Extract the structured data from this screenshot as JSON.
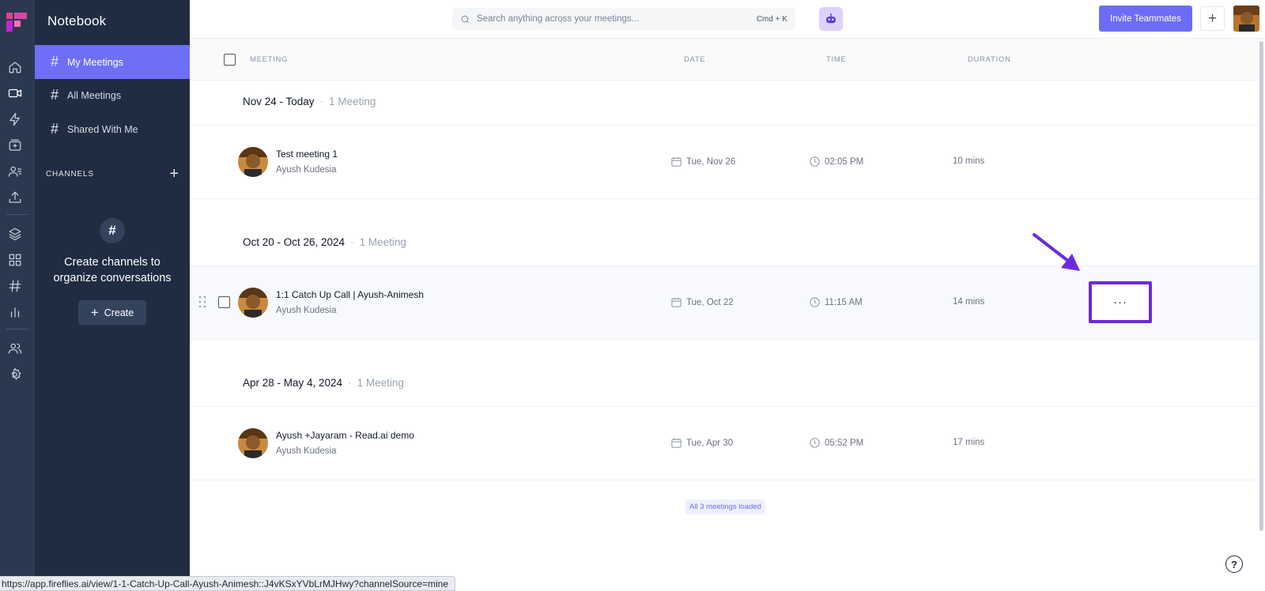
{
  "rail": {
    "items": [
      {
        "icon": "home-icon"
      },
      {
        "icon": "video-icon",
        "active": true
      },
      {
        "icon": "lightning-icon"
      },
      {
        "icon": "inbox-icon"
      },
      {
        "icon": "contacts-icon"
      },
      {
        "icon": "upload-icon"
      },
      {
        "icon": "layers-icon"
      },
      {
        "icon": "apps-grid-icon"
      },
      {
        "icon": "hash-icon"
      },
      {
        "icon": "analytics-icon"
      },
      {
        "icon": "team-icon"
      },
      {
        "icon": "settings-icon"
      }
    ]
  },
  "sidebar": {
    "title": "Notebook",
    "items": [
      {
        "label": "My Meetings",
        "active": true
      },
      {
        "label": "All Meetings"
      },
      {
        "label": "Shared With Me"
      }
    ],
    "channels_label": "CHANNELS",
    "empty_text": "Create channels to organize conversations",
    "create_label": "Create"
  },
  "header": {
    "search_placeholder": "Search anything across your meetings...",
    "search_shortcut": "Cmd + K",
    "invite_label": "Invite Teammates",
    "add_label": "+"
  },
  "columns": {
    "meeting": "MEETING",
    "date": "DATE",
    "time": "TIME",
    "duration": "DURATION"
  },
  "groups": [
    {
      "range": "Nov 24 - Today",
      "count": "1 Meeting",
      "meetings": [
        {
          "title": "Test meeting 1",
          "owner": "Ayush Kudesia",
          "date": "Tue, Nov 26",
          "time": "02:05 PM",
          "duration": "10 mins"
        }
      ]
    },
    {
      "range": "Oct 20 - Oct 26, 2024",
      "count": "1 Meeting",
      "meetings": [
        {
          "title": "1:1 Catch Up Call | Ayush-Animesh",
          "owner": "Ayush Kudesia",
          "date": "Tue, Oct 22",
          "time": "11:15 AM",
          "duration": "14 mins",
          "more": "···"
        }
      ]
    },
    {
      "range": "Apr 28 - May 4, 2024",
      "count": "1 Meeting",
      "meetings": [
        {
          "title": "Ayush +Jayaram - Read.ai demo",
          "owner": "Ayush Kudesia",
          "date": "Tue, Apr 30",
          "time": "05:52 PM",
          "duration": "17 mins"
        }
      ]
    }
  ],
  "footer": {
    "loaded_text": "All 3 meetings loaded",
    "status_url": "https://app.fireflies.ai/view/1-1-Catch-Up-Call-Ayush-Animesh::J4vKSxYVbLrMJHwy?channelSource=mine",
    "help": "?"
  },
  "colors": {
    "accent": "#6d6cf6",
    "rail": "#2b3950",
    "sidebar": "#1f2c42",
    "highlight": "#6a2be0"
  }
}
